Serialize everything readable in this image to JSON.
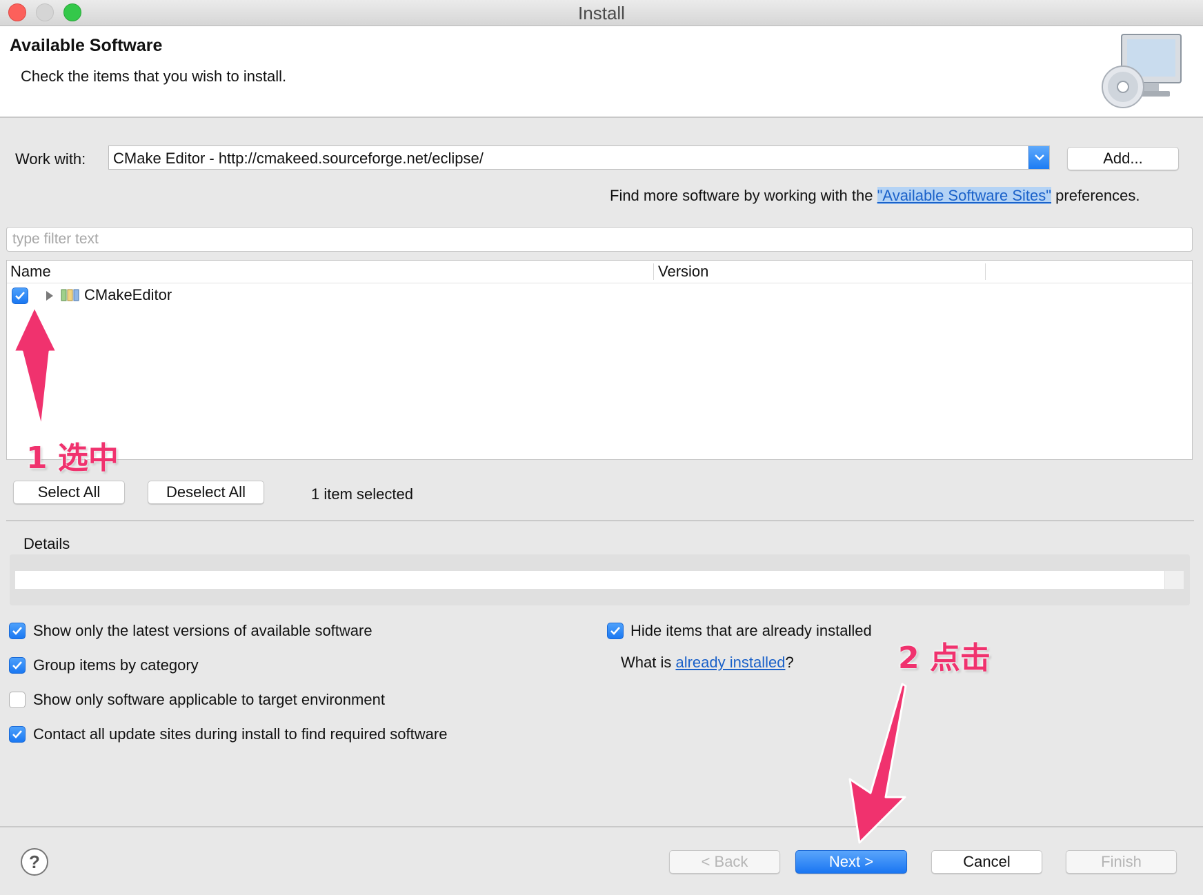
{
  "window": {
    "title": "Install"
  },
  "header": {
    "title": "Available Software",
    "subtitle": "Check the items that you wish to install."
  },
  "work_with": {
    "label": "Work with:",
    "value": "CMake Editor - http://cmakeed.sourceforge.net/eclipse/",
    "add_button": "Add..."
  },
  "find_more": {
    "prefix": "Find more software by working with the ",
    "link": "\"Available Software Sites\"",
    "suffix": " preferences."
  },
  "filter": {
    "placeholder": "type filter text",
    "value": ""
  },
  "table": {
    "columns": [
      "Name",
      "Version"
    ],
    "rows": [
      {
        "name": "CMakeEditor",
        "version": "",
        "checked": true
      }
    ]
  },
  "selection": {
    "select_all": "Select All",
    "deselect_all": "Deselect All",
    "status": "1 item selected"
  },
  "details": {
    "label": "Details",
    "text": ""
  },
  "options_left": [
    {
      "label": "Show only the latest versions of available software",
      "checked": true
    },
    {
      "label": "Group items by category",
      "checked": true
    },
    {
      "label": "Show only software applicable to target environment",
      "checked": false
    },
    {
      "label": "Contact all update sites during install to find required software",
      "checked": true
    }
  ],
  "options_right": {
    "hide_installed": {
      "label": "Hide items that are already installed",
      "checked": true
    },
    "what_is_prefix": "What is ",
    "what_is_link": "already installed",
    "what_is_suffix": "?"
  },
  "footer": {
    "help_icon": "?",
    "back": "< Back",
    "next": "Next >",
    "cancel": "Cancel",
    "finish": "Finish"
  },
  "annotations": {
    "step1": "1 选中",
    "step2": "2 点击",
    "color": "#f0326e"
  },
  "colors": {
    "accent": "#1a78f2",
    "link": "#1a61c9"
  }
}
